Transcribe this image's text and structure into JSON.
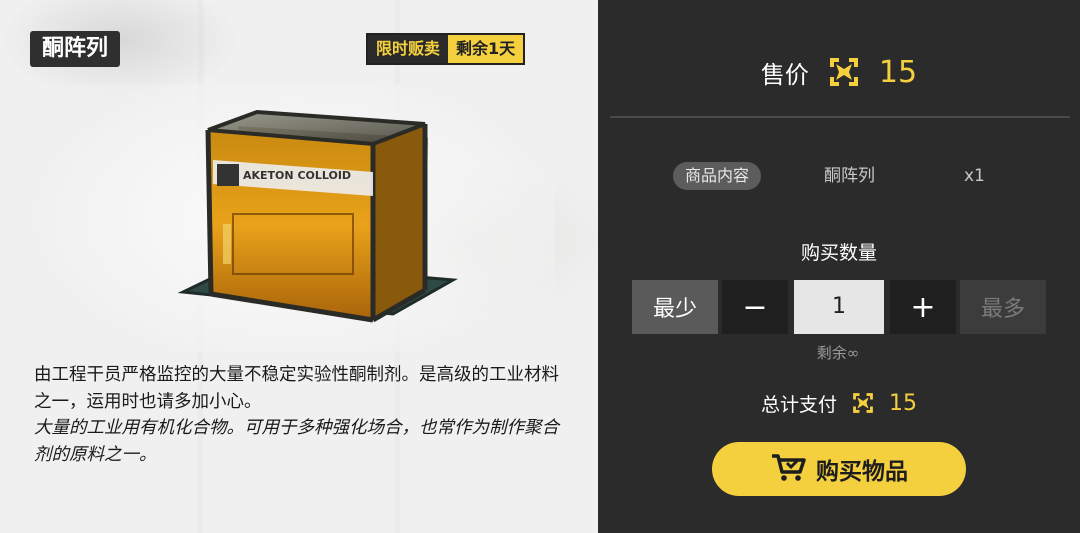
{
  "item": {
    "title": "酮阵列",
    "tag_limited": "限时贩卖",
    "tag_remaining": "剩余1天",
    "image_label": "AKETON COLLOID",
    "description_normal": "由工程干员严格监控的大量不稳定实验性酮制剂。是高级的工业材料之一，运用时也请多加小心。",
    "description_italic": "大量的工业用有机化合物。可用于多种强化场合，也常作为制作聚合剂的原料之一。"
  },
  "purchase": {
    "price_label": "售价",
    "price_value": "15",
    "contents_label": "商品内容",
    "contents_name": "酮阵列",
    "contents_qty": "x1",
    "qty_title": "购买数量",
    "min_label": "最少",
    "minus_label": "−",
    "quantity": "1",
    "plus_label": "+",
    "max_label": "最多",
    "stock_text": "剩余∞",
    "total_label": "总计支付",
    "total_value": "15",
    "buy_label": "购买物品"
  },
  "icons": {
    "currency": "certificate-currency-icon",
    "cart": "shopping-cart-icon"
  },
  "colors": {
    "accent": "#f4d03f",
    "panel_dark": "#2b2b2b",
    "panel_light": "#eeeeee"
  }
}
